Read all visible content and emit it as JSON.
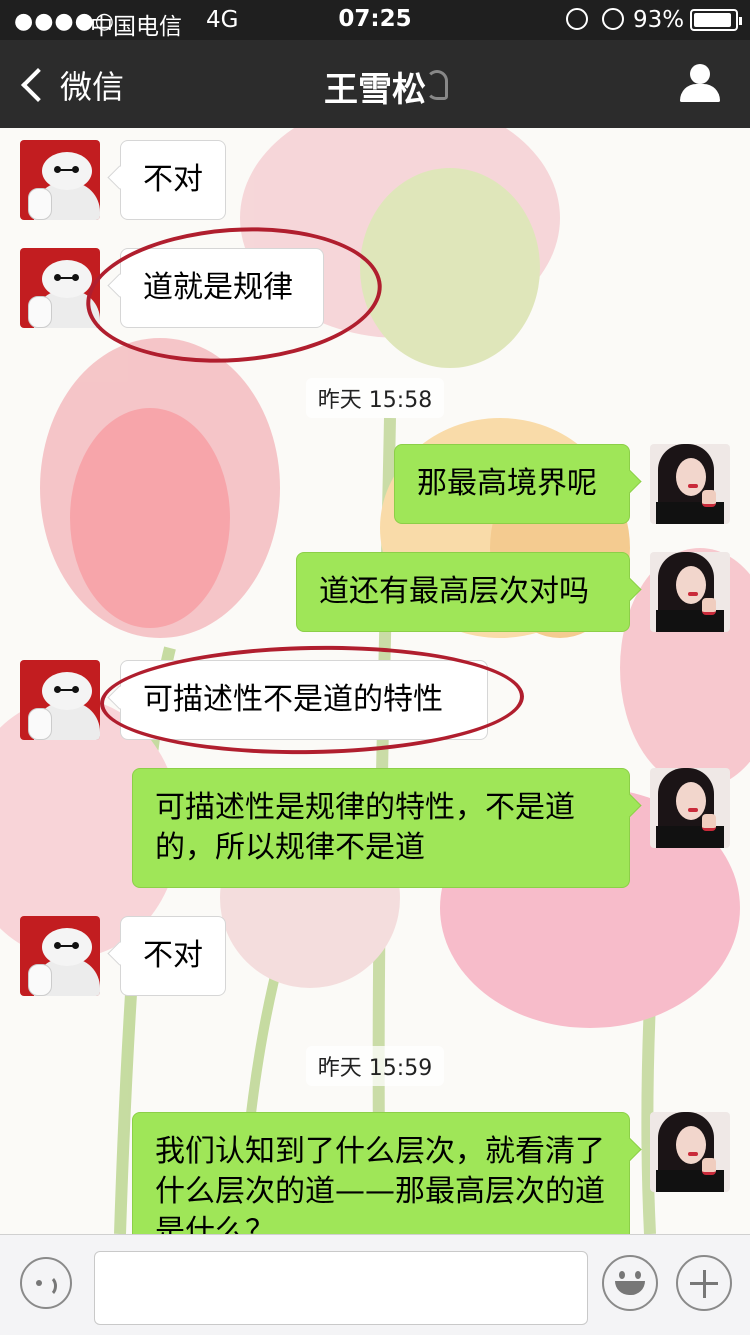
{
  "status_bar": {
    "signal": "●●●●○",
    "carrier": "中国电信",
    "network": "4G",
    "time": "07:25",
    "battery_percent": "93%",
    "battery_level": 0.93
  },
  "nav": {
    "back_label": "微信",
    "title": "王雪松"
  },
  "messages": [
    {
      "side": "in",
      "text": "不对",
      "avatar": "robot-avatar"
    },
    {
      "side": "in",
      "text": "道就是规律",
      "avatar": "robot-avatar"
    },
    {
      "side": "time",
      "text": "昨天 15:58"
    },
    {
      "side": "out",
      "text": "那最高境界呢",
      "avatar": "girl-avatar"
    },
    {
      "side": "out",
      "text": "道还有最高层次对吗",
      "avatar": "girl-avatar"
    },
    {
      "side": "in",
      "text": "可描述性不是道的特性",
      "avatar": "robot-avatar"
    },
    {
      "side": "out",
      "text": "可描述性是规律的特性，不是道的，所以规律不是道",
      "avatar": "girl-avatar"
    },
    {
      "side": "in",
      "text": "不对",
      "avatar": "robot-avatar"
    },
    {
      "side": "time",
      "text": "昨天 15:59"
    },
    {
      "side": "out",
      "text": "我们认知到了什么层次，就看清了什么层次的道——那最高层次的道是什么？",
      "avatar": "girl-avatar"
    }
  ],
  "input": {
    "value": "",
    "icons": [
      "voice-icon",
      "emoji-icon",
      "plus-icon"
    ]
  },
  "colors": {
    "out_bubble": "#9fe658",
    "in_bubble": "#ffffff",
    "annotation": "#b01e2e",
    "nav_bg": "#2c2c2c"
  }
}
